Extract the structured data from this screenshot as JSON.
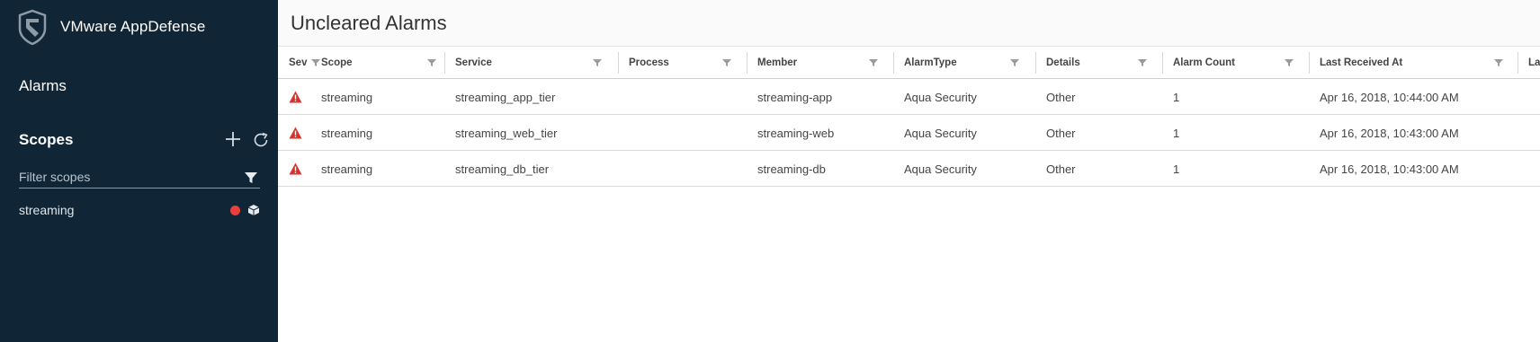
{
  "app": {
    "title": "VMware AppDefense",
    "logo_icon": "shield-logo-icon"
  },
  "sidebar": {
    "nav_alarms": "Alarms",
    "scopes_title": "Scopes",
    "add_icon": "plus-icon",
    "refresh_icon": "refresh-icon",
    "filter_placeholder": "Filter scopes",
    "filter_icon": "filter-icon",
    "scopes": [
      {
        "label": "streaming",
        "status_color": "#e8403f",
        "type_icon": "cube-icon"
      }
    ]
  },
  "main": {
    "title": "Uncleared Alarms",
    "columns": [
      "Sev",
      "Scope",
      "Service",
      "Process",
      "Member",
      "AlarmType",
      "Details",
      "Alarm Count",
      "Last Received At",
      "La"
    ],
    "rows": [
      {
        "sev": "warning-triangle-icon",
        "scope": "streaming",
        "service": "streaming_app_tier",
        "process": "",
        "member": "streaming-app",
        "alarm_type": "Aqua Security",
        "details": "Other",
        "alarm_count": "1",
        "last_received": "Apr 16, 2018, 10:44:00 AM"
      },
      {
        "sev": "warning-triangle-icon",
        "scope": "streaming",
        "service": "streaming_web_tier",
        "process": "",
        "member": "streaming-web",
        "alarm_type": "Aqua Security",
        "details": "Other",
        "alarm_count": "1",
        "last_received": "Apr 16, 2018, 10:43:00 AM"
      },
      {
        "sev": "warning-triangle-icon",
        "scope": "streaming",
        "service": "streaming_db_tier",
        "process": "",
        "member": "streaming-db",
        "alarm_type": "Aqua Security",
        "details": "Other",
        "alarm_count": "1",
        "last_received": "Apr 16, 2018, 10:43:00 AM"
      }
    ]
  },
  "colors": {
    "sidebar_bg": "#102535",
    "severity_red": "#d9322a",
    "status_dot": "#e8403f"
  }
}
